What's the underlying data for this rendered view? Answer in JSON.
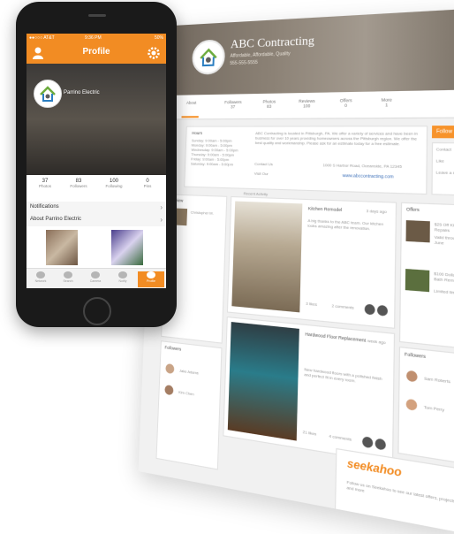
{
  "web": {
    "company_name": "ABC Contracting",
    "company_tagline": "Affordable, Affordable, Quality",
    "company_phone": "555-555-5555",
    "tabs": [
      "About",
      "Followers",
      "Photos",
      "Reviews",
      "Offers",
      "More"
    ],
    "tab_counts": [
      "37",
      "83",
      "100",
      "0",
      "1",
      ""
    ],
    "about_title": "Hours",
    "about_hours": [
      "Sunday: 9:00am - 5:00pm",
      "Monday: 9:00am - 5:00pm",
      "Wednesday: 9:00am - 5:00pm",
      "Thursday: 9:00am - 5:00pm",
      "Friday: 9:00am - 5:00pm",
      "Saturday: 9:00am - 5:00pm"
    ],
    "about_text": "ABC Contracting is located in Pittsburgh, PA. We offer a variety of services and have been in business for over 10 years providing homeowners across the Pittsburgh region. We offer the best quality and workmanship. Please ask for an estimate today for a free estimate.",
    "contact_label": "Contact Us",
    "address": "1000 S Harbor Road, Oceanside, PA 12345",
    "website_label": "Visit Our",
    "website": "www.abccontracting.com",
    "cta_label": "Follow",
    "side_buttons": [
      "Contact",
      "Like",
      "Leave a review"
    ],
    "recent_label": "Recent Activity",
    "review_card_title": "Review",
    "review_user": "Christopher M.",
    "post1_title": "Kitchen Remodel",
    "post1_time": "3 days ago",
    "post1_text": "A big thanks to the ABC team. Our kitchen looks amazing after the renovation.",
    "post1_likes": "3 likes",
    "post1_comments": "2 comments",
    "post2_title": "Hardwood Floor Replacement",
    "post2_time": "1 week ago",
    "post2_text": "New hardwood floors with a polished finish and perfect fit in every room.",
    "post2_likes": "21 likes",
    "post2_comments": "4 comments",
    "offers_title": "Offers",
    "offers": [
      {
        "title": "$25 Off Kitchen Repairs",
        "sub": "Valid through June"
      },
      {
        "title": "$100 Dollars Off Bath Remodel",
        "sub": "Limited time only"
      }
    ],
    "followers_title": "Followers",
    "followers": [
      "Sam Roberts",
      "Tom Perry"
    ],
    "left_followers": [
      "Jake Adams",
      "Kim Chen"
    ],
    "brand_logo": "seekahoo",
    "brand_tagline": "Follow us on Seekahoo to see our latest offers, projects, and more"
  },
  "phone": {
    "carrier": "●●○○○ AT&T",
    "time": "9:36 PM",
    "battery": "50%",
    "title": "Profile",
    "profile_name": "Parrino Electric",
    "stats": [
      {
        "n": "37",
        "l": "Photos"
      },
      {
        "n": "83",
        "l": "Followers"
      },
      {
        "n": "100",
        "l": "Following"
      },
      {
        "n": "0",
        "l": "Pins"
      }
    ],
    "rows": [
      "Notifications",
      "About Parrino Electric"
    ],
    "tab_items": [
      "Network",
      "Search",
      "Camera",
      "Notify",
      "Profile"
    ],
    "active_tab": 4
  },
  "colors": {
    "accent": "#f28c23",
    "blue_link": "#3b6fb8"
  }
}
